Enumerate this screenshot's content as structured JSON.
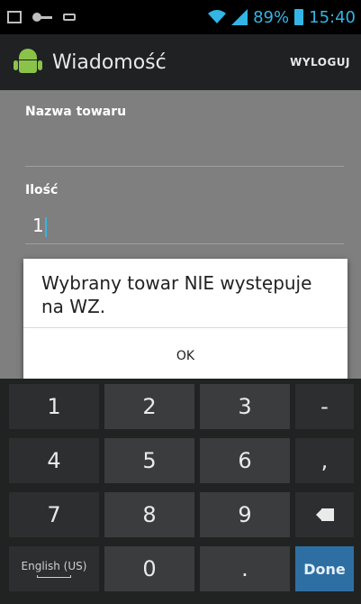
{
  "status_bar": {
    "battery_percent": "89%",
    "time": "15:40",
    "icons": [
      "image-icon",
      "key-icon",
      "usb-icon",
      "wifi-icon",
      "signal-icon",
      "battery-icon"
    ]
  },
  "action_bar": {
    "title": "Wiadomość",
    "logout_label": "WYLOGUJ",
    "app_icon": "android-icon"
  },
  "form": {
    "product_name_label": "Nazwa towaru",
    "product_name_value": "",
    "quantity_label": "Ilość",
    "quantity_value": "1"
  },
  "dialog": {
    "message": "Wybrany towar NIE występuje na WZ.",
    "ok_label": "OK"
  },
  "keyboard": {
    "rows": [
      [
        "1",
        "2",
        "3",
        "-"
      ],
      [
        "4",
        "5",
        "6",
        ","
      ],
      [
        "7",
        "8",
        "9",
        "⌫"
      ],
      [
        "English (US)",
        "0",
        ".",
        "Done"
      ]
    ],
    "language_label": "English (US)",
    "done_label": "Done"
  },
  "colors": {
    "accent": "#33b5e5",
    "action_bar": "#1f2122",
    "done_key": "#2e6fa3",
    "content_dimmed": "#7f7f7f"
  }
}
